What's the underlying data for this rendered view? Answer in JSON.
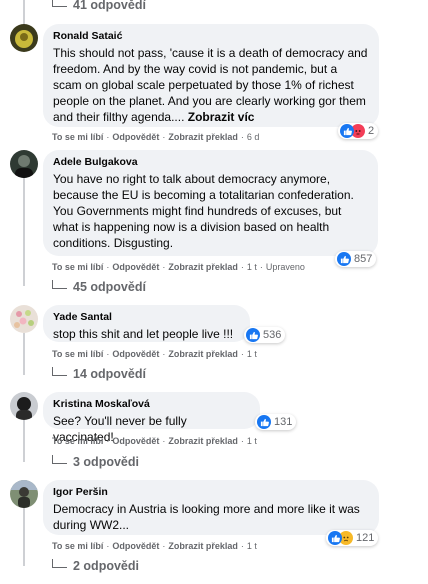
{
  "top_replies": "41 odpovědí",
  "comments": [
    {
      "author": "Ronald Sataić",
      "text": "This should not pass, 'cause it is a death of democracy and freedom. And by the way covid is not pandemic, but a scam on global scale perpetuated by those 1% of richest people on the planet. And you are clearly working gor them and their filthy agenda....",
      "see_more": "Zobrazit víc",
      "like": "To se mi líbí",
      "reply": "Odpovědět",
      "translate": "Zobrazit překlad",
      "time": "6 d",
      "edited": "",
      "reaction_count": "2",
      "replies": ""
    },
    {
      "author": "Adele Bulgakova",
      "text": "You have no right to talk about democracy anymore, because the EU is becoming a totalitarian confederation. You Governments might find hundreds of excuses, but what is happening now is a division based on health conditions. Disgusting.",
      "see_more": "",
      "like": "To se mi líbí",
      "reply": "Odpovědět",
      "translate": "Zobrazit překlad",
      "time": "1 t",
      "edited": "Upraveno",
      "reaction_count": "857",
      "replies": "45 odpovědí"
    },
    {
      "author": "Yade Santal",
      "text": "stop this shit and let people live !!!",
      "see_more": "",
      "like": "To se mi líbí",
      "reply": "Odpovědět",
      "translate": "Zobrazit překlad",
      "time": "1 t",
      "edited": "",
      "reaction_count": "536",
      "replies": "14 odpovědí"
    },
    {
      "author": "Kristina Moskaľová",
      "text": "See? You'll never be fully vaccinated!",
      "see_more": "",
      "like": "To se mi líbí",
      "reply": "Odpovědět",
      "translate": "Zobrazit překlad",
      "time": "1 t",
      "edited": "",
      "reaction_count": "131",
      "replies": "3 odpovědi"
    },
    {
      "author": "Igor Peršin",
      "text": "Democracy in Austria is looking more and more like it was during WW2...",
      "see_more": "",
      "like": "To se mi líbí",
      "reply": "Odpovědět",
      "translate": "Zobrazit překlad",
      "time": "1 t",
      "edited": "",
      "reaction_count": "121",
      "replies": "2 odpovědi"
    }
  ],
  "colors": {
    "bubble": "#f0f2f5",
    "meta": "#65676b",
    "like": "#1877f2",
    "angry": "#f33e58",
    "sad": "#f7b928"
  },
  "icons": [
    "like-icon",
    "angry-icon",
    "sad-icon",
    "reply-arrow-icon"
  ]
}
